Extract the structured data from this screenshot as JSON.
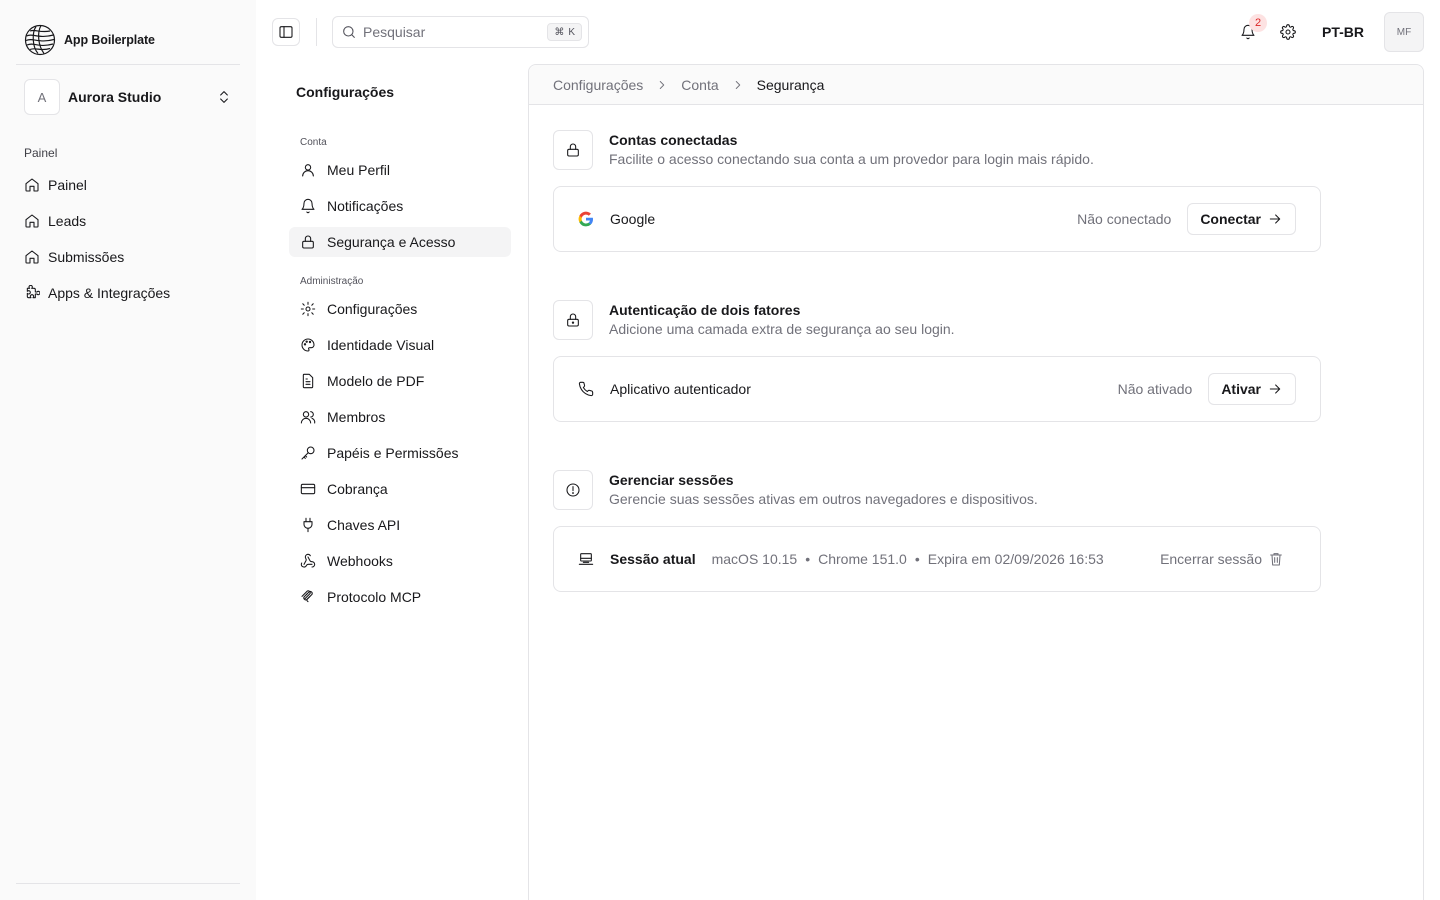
{
  "brand": {
    "name": "App Boilerplate",
    "icon": "globe-logo"
  },
  "org": {
    "initial": "A",
    "name": "Aurora Studio",
    "icon": "chevrons-up-down-icon"
  },
  "sidebar": {
    "section_label": "Painel",
    "items": [
      {
        "label": "Painel",
        "icon": "home-icon"
      },
      {
        "label": "Leads",
        "icon": "home-icon"
      },
      {
        "label": "Submissões",
        "icon": "home-icon"
      },
      {
        "label": "Apps & Integrações",
        "icon": "puzzle-icon"
      }
    ]
  },
  "header": {
    "search_placeholder": "Pesquisar",
    "shortcut_symbol": "⌘",
    "shortcut_key": "K",
    "notification_count": "2",
    "language": "PT-BR",
    "user_initials": "MF"
  },
  "settings_nav": {
    "title": "Configurações",
    "group_account": "Conta",
    "account_items": [
      {
        "label": "Meu Perfil",
        "icon": "user-icon"
      },
      {
        "label": "Notificações",
        "icon": "bell-icon"
      },
      {
        "label": "Segurança e Acesso",
        "icon": "lock-icon",
        "active": true
      }
    ],
    "group_admin": "Administração",
    "admin_items": [
      {
        "label": "Configurações",
        "icon": "gear-icon"
      },
      {
        "label": "Identidade Visual",
        "icon": "palette-icon"
      },
      {
        "label": "Modelo de PDF",
        "icon": "file-text-icon"
      },
      {
        "label": "Membros",
        "icon": "users-icon"
      },
      {
        "label": "Papéis e Permissões",
        "icon": "key-icon"
      },
      {
        "label": "Cobrança",
        "icon": "credit-card-icon"
      },
      {
        "label": "Chaves API",
        "icon": "plug-icon"
      },
      {
        "label": "Webhooks",
        "icon": "webhook-icon"
      },
      {
        "label": "Protocolo MCP",
        "icon": "mcp-icon"
      }
    ]
  },
  "breadcrumb": [
    "Configurações",
    "Conta",
    "Segurança"
  ],
  "sections": {
    "connected": {
      "title": "Contas conectadas",
      "description": "Facilite o acesso conectando sua conta a um provedor para login mais rápido.",
      "provider": "Google",
      "status": "Não conectado",
      "button": "Conectar"
    },
    "twofa": {
      "title": "Autenticação de dois fatores",
      "description": "Adicione uma camada extra de segurança ao seu login.",
      "method": "Aplicativo autenticador",
      "status": "Não ativado",
      "button": "Ativar"
    },
    "sessions": {
      "title": "Gerenciar sessões",
      "description": "Gerencie suas sessões ativas em outros navegadores e dispositivos.",
      "current_label": "Sessão atual",
      "os": "macOS 10.15",
      "dot": "•",
      "browser": "Chrome 151.0",
      "expires": "Expira em 02/09/2026 16:53",
      "end_label": "Encerrar sessão"
    }
  },
  "colors": {
    "accent_badge": "#dc2626",
    "badge_bg": "#fde2e2",
    "sidebar_bg": "#fafafa",
    "border": "#e4e4e7"
  }
}
